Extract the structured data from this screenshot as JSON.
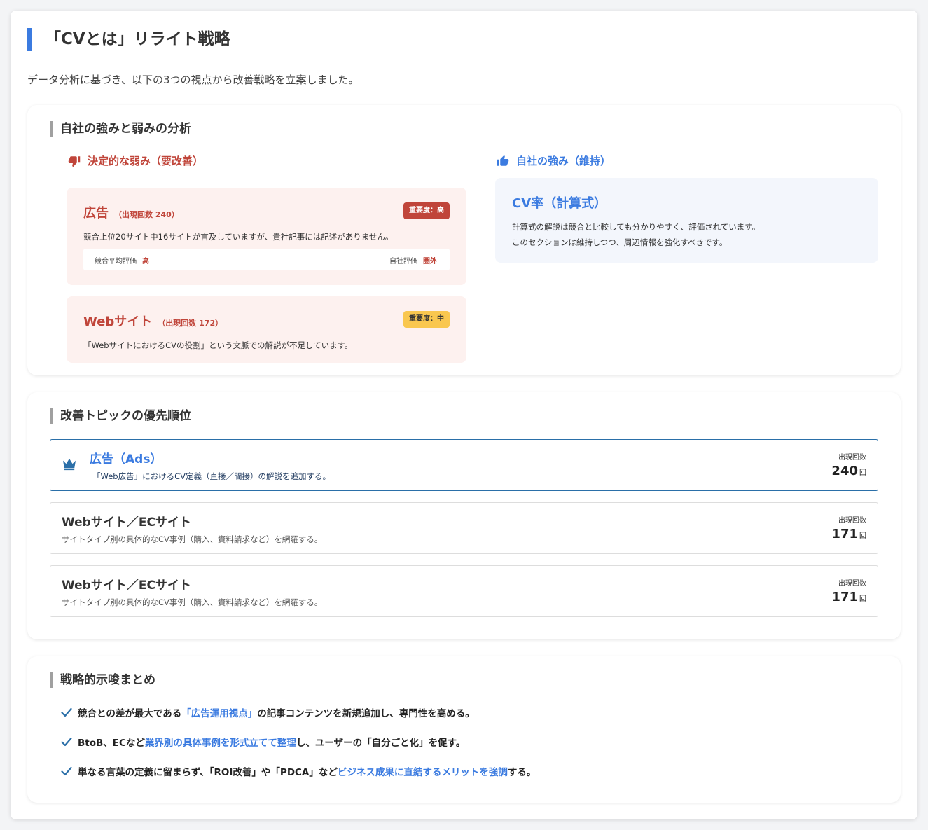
{
  "page": {
    "title": "「CVとは」リライト戦略",
    "intro": "データ分析に基づき、以下の3つの視点から改善戦略を立案しました。"
  },
  "analysis": {
    "title": "自社の強みと弱みの分析",
    "weak_heading": "決定的な弱み（要改善）",
    "strong_heading": "自社の強み（維持）",
    "weak_items": [
      {
        "title": "広告",
        "count_label": "（出現回数 240）",
        "badge": "重要度：高",
        "desc": "競合上位20サイト中16サイトが言及していますが、貴社記事には記述がありません。",
        "competitor_label": "競合平均評価",
        "competitor_value": "高",
        "own_label": "自社評価",
        "own_value": "圏外"
      },
      {
        "title": "Webサイト",
        "count_label": "（出現回数 172）",
        "badge": "重要度：中",
        "desc": "「WebサイトにおけるCVの役割」という文脈での解説が不足しています。"
      }
    ],
    "strong_item": {
      "title": "CV率（計算式）",
      "line1": "計算式の解説は競合と比較しても分かりやすく、評価されています。",
      "line2": "このセクションは維持しつつ、周辺情報を強化すべきです。"
    }
  },
  "priority": {
    "title": "改善トピックの優先順位",
    "count_label": "出現回数",
    "unit": "回",
    "topics": [
      {
        "title": "広告（Ads）",
        "desc": "「Web広告」におけるCV定義（直接／間接）の解説を追加する。",
        "count": "240"
      },
      {
        "title": "Webサイト／ECサイト",
        "desc": "サイトタイプ別の具体的なCV事例（購入、資料請求など）を網羅する。",
        "count": "171"
      },
      {
        "title": "Webサイト／ECサイト",
        "desc": "サイトタイプ別の具体的なCV事例（購入、資料請求など）を網羅する。",
        "count": "171"
      }
    ]
  },
  "summary": {
    "title": "戦略的示唆まとめ",
    "items": [
      {
        "pre": "競合との差が最大である",
        "hl": "「広告運用視点」",
        "post": "の記事コンテンツを新規追加し、専門性を高める。"
      },
      {
        "pre": "BtoB、ECなど",
        "hl": "業界別の具体事例を形式立てて整理",
        "post": "し、ユーザーの「自分ごと化」を促す。"
      },
      {
        "pre": "単なる言葉の定義に留まらず、「ROI改善」や「PDCA」など",
        "hl": "ビジネス成果に直結するメリットを強調",
        "post": "する。"
      }
    ]
  },
  "colors": {
    "accent_blue": "#3b7be0",
    "weak_red": "#c0453a",
    "badge_mid": "#f9c74f"
  }
}
